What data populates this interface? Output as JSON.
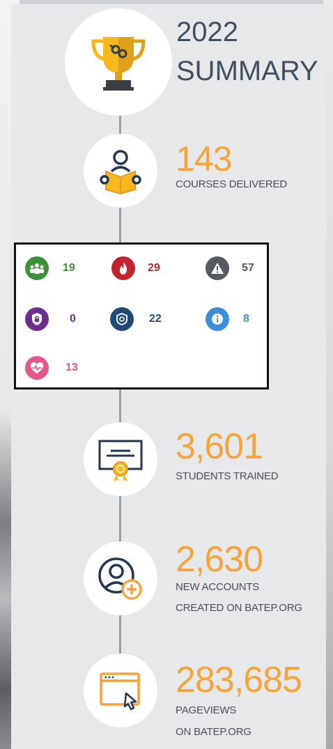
{
  "header": {
    "year": "2022",
    "title": "SUMMARY"
  },
  "courses": {
    "value": "143",
    "label": "COURSES DELIVERED"
  },
  "stats": [
    {
      "icon": "group-icon",
      "value": "19",
      "color": "#3f8f3a"
    },
    {
      "icon": "fire-icon",
      "value": "29",
      "color": "#c0242c"
    },
    {
      "icon": "warning-icon",
      "value": "57",
      "color": "#555a61"
    },
    {
      "icon": "lock-shield-icon",
      "value": "0",
      "color": "#6b2f8f"
    },
    {
      "icon": "badge-icon",
      "value": "22",
      "color": "#1f4b7a"
    },
    {
      "icon": "info-icon",
      "value": "8",
      "color": "#3c8fd6"
    },
    {
      "icon": "heart-icon",
      "value": "13",
      "color": "#e5588c"
    }
  ],
  "students": {
    "value": "3,601",
    "label": "STUDENTS TRAINED"
  },
  "accounts": {
    "value": "2,630",
    "label1": "NEW ACCOUNTS",
    "label2": "CREATED ON BATEP.ORG"
  },
  "pageviews": {
    "value": "283,685",
    "label1": "PAGEVIEWS",
    "label2": "ON BATEP.ORG"
  }
}
